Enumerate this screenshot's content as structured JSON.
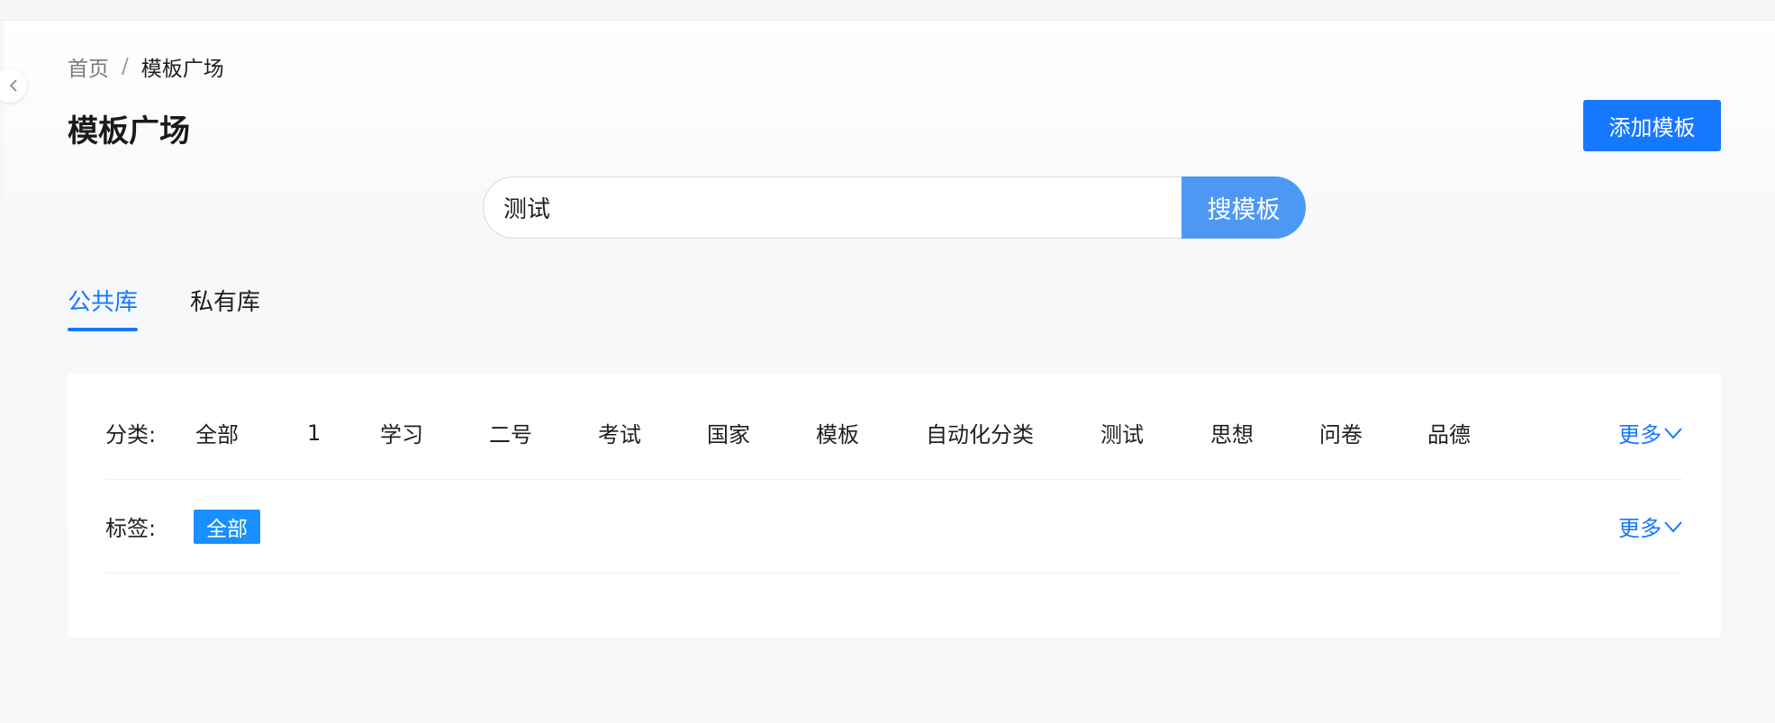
{
  "breadcrumb": {
    "home": "首页",
    "separator": "/",
    "current": "模板广场"
  },
  "page": {
    "title": "模板广场",
    "add_button": "添加模板"
  },
  "search": {
    "value": "测试",
    "button": "搜模板"
  },
  "tabs": [
    {
      "label": "公共库",
      "active": true
    },
    {
      "label": "私有库",
      "active": false
    }
  ],
  "filters": {
    "category_label": "分类:",
    "categories": [
      "全部",
      "1",
      "学习",
      "二号",
      "考试",
      "国家",
      "模板",
      "自动化分类",
      "测试",
      "思想",
      "问卷",
      "品德"
    ],
    "tag_label": "标签:",
    "tags": [
      "全部"
    ],
    "more": "更多"
  },
  "colors": {
    "primary": "#1677ff",
    "search_button": "#4d98f5",
    "tag_chip": "#1890ff"
  }
}
